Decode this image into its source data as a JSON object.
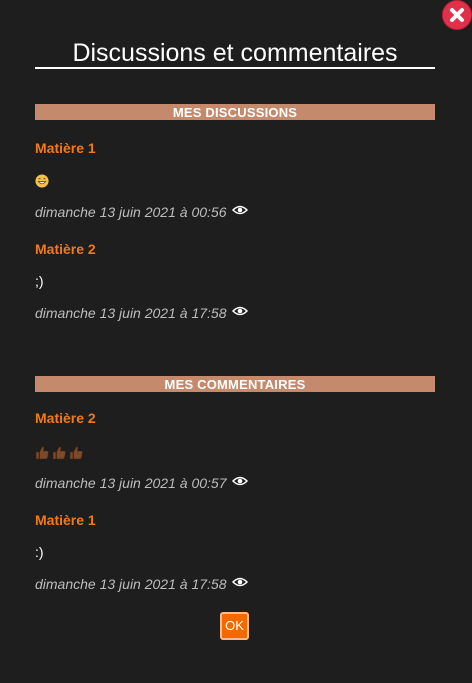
{
  "modal": {
    "title": "Discussions et commentaires",
    "close_icon": "close-x-icon",
    "ok_label": "OK"
  },
  "discussions": {
    "header": "MES DISCUSSIONS",
    "items": [
      {
        "subject": "Matière 1",
        "message": "grinning-face-emoji",
        "date": "dimanche 13 juin 2021 à 00:56",
        "view_icon": "eye-icon"
      },
      {
        "subject": "Matière 2",
        "message": ";)",
        "date": "dimanche 13 juin 2021 à 17:58",
        "view_icon": "eye-icon"
      }
    ]
  },
  "comments": {
    "header": "MES COMMENTAIRES",
    "items": [
      {
        "subject": "Matière 2",
        "message": "three-thumbs-up-emoji",
        "date": "dimanche 13 juin 2021 à 00:57",
        "view_icon": "eye-icon"
      },
      {
        "subject": "Matière 1",
        "message": ":)",
        "date": "dimanche 13 juin 2021 à 17:58",
        "view_icon": "eye-icon"
      }
    ]
  },
  "colors": {
    "background": "#1f1e1e",
    "section_header": "#c58a6b",
    "subject": "#f07a1a",
    "ok_button": "#f06a00",
    "close_button": "#e0304a"
  }
}
